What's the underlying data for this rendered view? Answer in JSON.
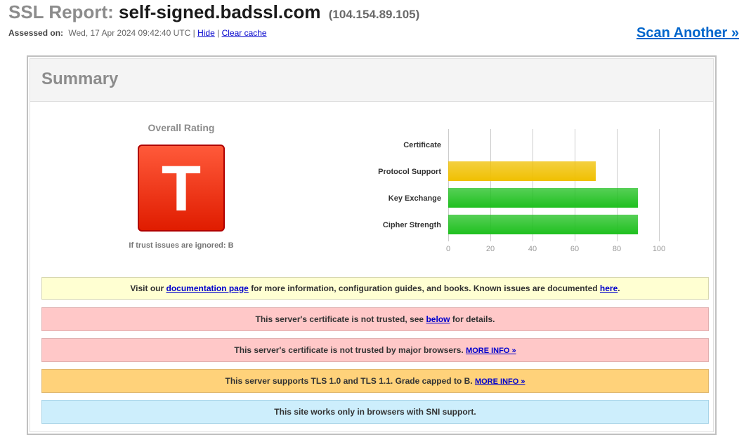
{
  "header": {
    "prefix": "SSL Report:",
    "host": "self-signed.badssl.com",
    "ip": "(104.154.89.105)",
    "assessed_label": "Assessed on:",
    "assessed_value": "Wed, 17 Apr 2024 09:42:40 UTC |",
    "hide_link": "Hide",
    "separator": "|",
    "clear_cache_link": "Clear cache",
    "scan_another": "Scan Another »"
  },
  "summary": {
    "title": "Summary",
    "overall_rating_label": "Overall Rating",
    "grade": "T",
    "trust_note": "If trust issues are ignored: B"
  },
  "chart_data": {
    "type": "bar",
    "orientation": "horizontal",
    "categories": [
      "Certificate",
      "Protocol Support",
      "Key Exchange",
      "Cipher Strength"
    ],
    "values": [
      0,
      70,
      90,
      90
    ],
    "colors": [
      "#cccccc",
      "#f0c000",
      "#1fc01f",
      "#1fc01f"
    ],
    "xlim": [
      0,
      100
    ],
    "xticks": [
      "0",
      "20",
      "40",
      "60",
      "80",
      "100"
    ],
    "grid": true
  },
  "notices": {
    "docs": {
      "pre": "Visit our",
      "link": "documentation page",
      "mid": "for more information, configuration guides, and books. Known issues are documented",
      "link2": "here",
      "post": "."
    },
    "not_trusted": {
      "pre": "This server's certificate is not trusted, see",
      "link": "below",
      "post": "for details."
    },
    "major_browsers": {
      "text": "This server's certificate is not trusted by major browsers.",
      "link": "MORE INFO »"
    },
    "tls": {
      "text": "This server supports TLS 1.0 and TLS 1.1. Grade capped to B.",
      "link": "MORE INFO »"
    },
    "sni": {
      "text": "This site works only in browsers with SNI support."
    }
  }
}
